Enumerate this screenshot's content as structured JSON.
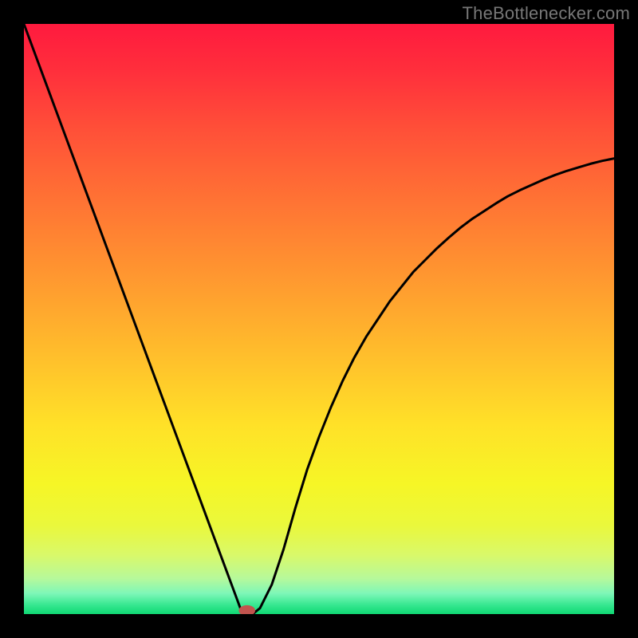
{
  "watermark": {
    "text": "TheBottlenecker.com"
  },
  "chart_data": {
    "type": "line",
    "title": "",
    "xlabel": "",
    "ylabel": "",
    "xlim": [
      0,
      100
    ],
    "ylim": [
      0,
      100
    ],
    "x": [
      0,
      2,
      4,
      6,
      8,
      10,
      12,
      14,
      16,
      18,
      20,
      22,
      24,
      26,
      28,
      30,
      32,
      34,
      36,
      37,
      38,
      39,
      40,
      42,
      44,
      46,
      48,
      50,
      52,
      54,
      56,
      58,
      60,
      62,
      64,
      66,
      68,
      70,
      72,
      74,
      76,
      78,
      80,
      82,
      84,
      86,
      88,
      90,
      92,
      94,
      96,
      98,
      100
    ],
    "values": [
      100,
      94.6,
      89.2,
      83.8,
      78.4,
      73.0,
      67.6,
      62.2,
      56.8,
      51.4,
      46.0,
      40.6,
      35.2,
      29.8,
      24.4,
      19.0,
      13.6,
      8.2,
      2.8,
      0.1,
      0.0,
      0.2,
      1.0,
      5.0,
      11.0,
      18.0,
      24.5,
      30.0,
      35.0,
      39.5,
      43.5,
      47.0,
      50.0,
      53.0,
      55.5,
      58.0,
      60.0,
      62.0,
      63.8,
      65.5,
      67.0,
      68.3,
      69.6,
      70.8,
      71.8,
      72.7,
      73.6,
      74.4,
      75.1,
      75.7,
      76.3,
      76.8,
      77.2
    ],
    "marker": {
      "x": 37.8,
      "y": 0.6,
      "rx": 1.4,
      "ry": 0.9
    },
    "gradient_stops": [
      {
        "offset": 0.0,
        "color": "#ff1a3e"
      },
      {
        "offset": 0.08,
        "color": "#ff2f3c"
      },
      {
        "offset": 0.18,
        "color": "#ff5038"
      },
      {
        "offset": 0.3,
        "color": "#ff7334"
      },
      {
        "offset": 0.42,
        "color": "#ff9530"
      },
      {
        "offset": 0.55,
        "color": "#ffbb2c"
      },
      {
        "offset": 0.68,
        "color": "#ffe128"
      },
      {
        "offset": 0.78,
        "color": "#f6f626"
      },
      {
        "offset": 0.85,
        "color": "#eaf83c"
      },
      {
        "offset": 0.9,
        "color": "#d9f96a"
      },
      {
        "offset": 0.94,
        "color": "#b6f99b"
      },
      {
        "offset": 0.965,
        "color": "#7ef7b8"
      },
      {
        "offset": 0.985,
        "color": "#35e78f"
      },
      {
        "offset": 1.0,
        "color": "#0fd873"
      }
    ],
    "curve_stroke": "#000000",
    "curve_width": 3,
    "marker_fill": "#c1544e"
  }
}
